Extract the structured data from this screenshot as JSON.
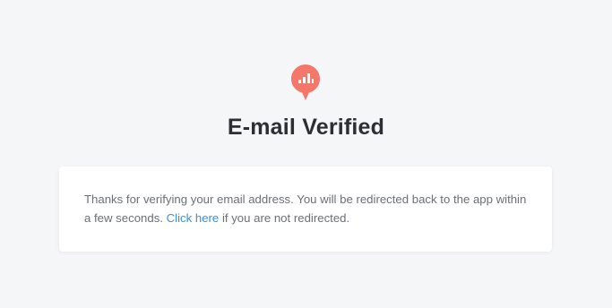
{
  "logo": {
    "icon": "chart-bubble-icon",
    "color": "#f4776a"
  },
  "title": "E-mail Verified",
  "message": {
    "before_link": "Thanks for verifying your email address. You will be redirected back to the app within a few seconds. ",
    "link_text": "Click here",
    "after_link": " if you are not redirected."
  },
  "colors": {
    "background": "#f5f6f8",
    "card": "#ffffff",
    "title": "#2b2f35",
    "text": "#6a6f78",
    "link": "#3b8fd6"
  }
}
